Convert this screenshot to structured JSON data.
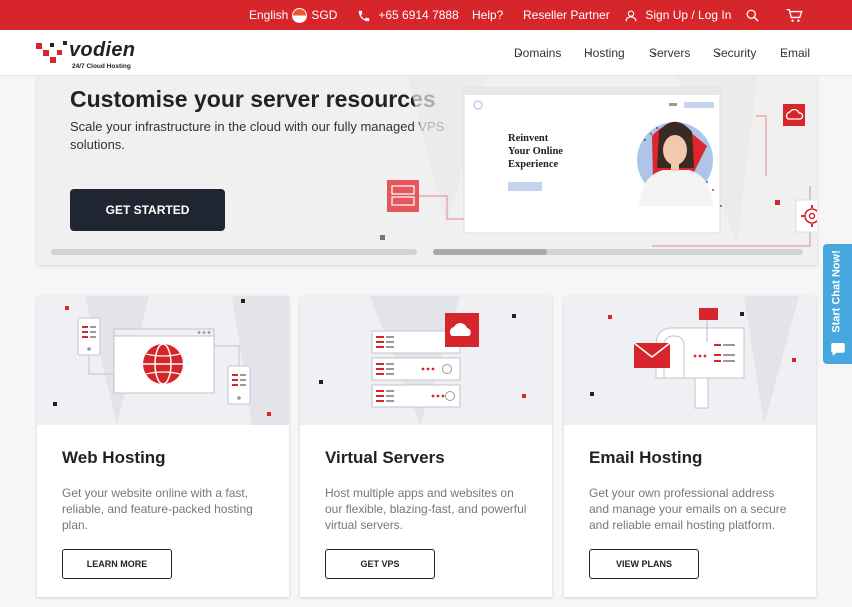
{
  "topbar": {
    "language": "English",
    "currency": "SGD",
    "phone": "+65 6914 7888",
    "help": "Help?",
    "reseller": "Reseller Partner",
    "signin": "Sign Up / Log In"
  },
  "nav": {
    "logo_text": "vodien",
    "logo_tagline": "24/7 Cloud Hosting",
    "items": [
      "Domains",
      "Hosting",
      "Servers",
      "Security",
      "Email"
    ]
  },
  "hero": {
    "title": "Customise your server resources",
    "subtitle": "Scale your infrastructure in the cloud with our fully managed VPS solutions.",
    "cta": "GET STARTED",
    "mockup_headline": "Reinvent Your Online Experience"
  },
  "cards": [
    {
      "title": "Web Hosting",
      "desc": "Get your website online with a fast, reliable, and feature-packed hosting plan.",
      "cta": "LEARN MORE"
    },
    {
      "title": "Virtual Servers",
      "desc": "Host multiple apps and websites on our flexible, blazing-fast, and powerful virtual servers.",
      "cta": "GET VPS"
    },
    {
      "title": "Email Hosting",
      "desc": "Get your own professional address and manage your emails on a secure and reliable email hosting platform.",
      "cta": "VIEW PLANS"
    }
  ],
  "chat": {
    "label": "Start Chat Now!"
  },
  "colors": {
    "brand": "#d7262b",
    "dark_button": "#1f2531",
    "chat": "#47a8e0"
  }
}
